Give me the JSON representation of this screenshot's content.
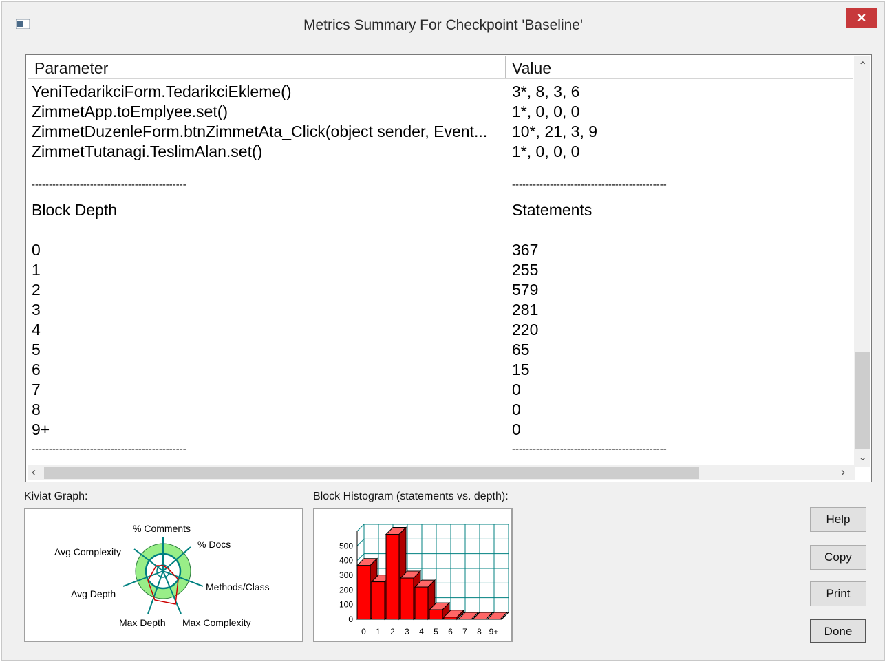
{
  "window": {
    "title": "Metrics Summary For Checkpoint 'Baseline'",
    "close_glyph": "×"
  },
  "columns": {
    "parameter": "Parameter",
    "value": "Value"
  },
  "method_rows": [
    {
      "parameter": "YeniTedarikciForm.TedarikciEkleme()",
      "value": "3*, 8, 3, 6"
    },
    {
      "parameter": "ZimmetApp.toEmplyee.set()",
      "value": "1*, 0, 0, 0"
    },
    {
      "parameter": "ZimmetDuzenleForm.btnZimmetAta_Click(object sender, Event...",
      "value": "10*, 21, 3, 9"
    },
    {
      "parameter": "ZimmetTutanagi.TeslimAlan.set()",
      "value": "1*, 0, 0, 0"
    }
  ],
  "separator": "---------------------------------------------",
  "block_section": {
    "depth_header": "Block Depth",
    "statements_header": "Statements"
  },
  "block_rows": [
    {
      "depth": "0",
      "statements": "367"
    },
    {
      "depth": "1",
      "statements": "255"
    },
    {
      "depth": "2",
      "statements": "579"
    },
    {
      "depth": "3",
      "statements": "281"
    },
    {
      "depth": "4",
      "statements": "220"
    },
    {
      "depth": "5",
      "statements": "65"
    },
    {
      "depth": "6",
      "statements": "15"
    },
    {
      "depth": "7",
      "statements": "0"
    },
    {
      "depth": "8",
      "statements": "0"
    },
    {
      "depth": "9+",
      "statements": "0"
    }
  ],
  "kiviat": {
    "caption": "Kiviat Graph:",
    "labels": [
      "% Comments",
      "% Docs",
      "Methods/Class",
      "Max Complexity",
      "Max Depth",
      "Avg Depth",
      "Avg Complexity"
    ]
  },
  "histogram": {
    "caption": "Block Histogram (statements vs. depth):",
    "y_ticks": [
      "500",
      "400",
      "300",
      "200",
      "100",
      "0"
    ]
  },
  "chart_data": {
    "type": "bar",
    "categories": [
      "0",
      "1",
      "2",
      "3",
      "4",
      "5",
      "6",
      "7",
      "8",
      "9+"
    ],
    "values": [
      367,
      255,
      579,
      281,
      220,
      65,
      15,
      0,
      0,
      0
    ],
    "ylim": [
      0,
      600
    ],
    "bar_color": "#ff0000",
    "grid_color": "#008080"
  },
  "buttons": {
    "help": "Help",
    "copy": "Copy",
    "print": "Print",
    "done": "Done"
  },
  "colors": {
    "close_bg": "#c7393b",
    "kiviat_fill": "#99ee88",
    "bar": "#ff0000",
    "grid": "#008080"
  }
}
